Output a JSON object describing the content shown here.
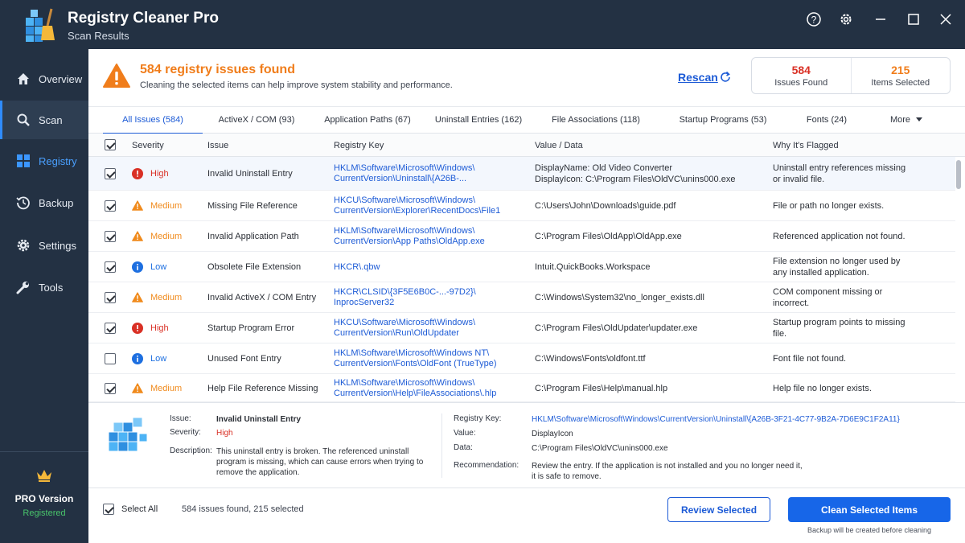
{
  "app": {
    "title": "Registry Cleaner Pro",
    "subtitle": "Scan Results"
  },
  "window_controls": [
    "help-icon",
    "settings-icon",
    "minimize-icon",
    "maximize-icon",
    "close-icon"
  ],
  "sidebar": {
    "items": [
      {
        "label": "Overview",
        "icon": "home-icon"
      },
      {
        "label": "Scan",
        "icon": "search-icon"
      },
      {
        "label": "Registry",
        "icon": "grid-icon"
      },
      {
        "label": "Backup",
        "icon": "history-icon"
      },
      {
        "label": "Settings",
        "icon": "gear-icon"
      },
      {
        "label": "Tools",
        "icon": "wrench-icon"
      }
    ],
    "pro": {
      "title": "PRO Version",
      "status": "Registered"
    }
  },
  "header": {
    "title": "584 registry issues found",
    "subtitle": "Cleaning the selected items can help improve system stability and performance.",
    "rescan": "Rescan",
    "stats": [
      {
        "value": "584",
        "label": "Issues Found",
        "color": "#d93025"
      },
      {
        "value": "215",
        "label": "Items Selected",
        "color": "#f07d1b"
      }
    ]
  },
  "tabs": [
    "All Issues (584)",
    "ActiveX / COM (93)",
    "Application Paths (67)",
    "Uninstall Entries (162)",
    "File Associations (118)",
    "Startup Programs (53)",
    "Fonts (24)",
    "More"
  ],
  "table": {
    "headers": [
      "Severity",
      "Issue",
      "Registry Key",
      "Value / Data",
      "Why It's Flagged"
    ],
    "rows": [
      {
        "checked": true,
        "severity": "High",
        "issue": "Invalid Uninstall Entry",
        "key": [
          "HKLM\\Software\\Microsoft\\Windows\\",
          "CurrentVersion\\Uninstall\\{A26B-..."
        ],
        "value": [
          "DisplayName: Old Video Converter",
          "DisplayIcon: C:\\Program Files\\OldVC\\unins000.exe"
        ],
        "why": [
          "Uninstall entry references missing",
          "or invalid file."
        ]
      },
      {
        "checked": true,
        "severity": "Medium",
        "issue": "Missing File Reference",
        "key": [
          "HKCU\\Software\\Microsoft\\Windows\\",
          "CurrentVersion\\Explorer\\RecentDocs\\File1"
        ],
        "value": [
          "C:\\Users\\John\\Downloads\\guide.pdf"
        ],
        "why": [
          "File or path no longer exists."
        ]
      },
      {
        "checked": true,
        "severity": "Medium",
        "issue": "Invalid Application Path",
        "key": [
          "HKLM\\Software\\Microsoft\\Windows\\",
          "CurrentVersion\\App Paths\\OldApp.exe"
        ],
        "value": [
          "C:\\Program Files\\OldApp\\OldApp.exe"
        ],
        "why": [
          "Referenced application not found."
        ]
      },
      {
        "checked": true,
        "severity": "Low",
        "issue": "Obsolete File Extension",
        "key": [
          "HKCR\\.qbw"
        ],
        "value": [
          "Intuit.QuickBooks.Workspace"
        ],
        "why": [
          "File extension no longer used by",
          "any installed application."
        ]
      },
      {
        "checked": true,
        "severity": "Medium",
        "issue": "Invalid ActiveX / COM Entry",
        "key": [
          "HKCR\\CLSID\\{3F5E6B0C-...-97D2}\\",
          "InprocServer32"
        ],
        "value": [
          "C:\\Windows\\System32\\no_longer_exists.dll"
        ],
        "why": [
          "COM component missing or",
          "incorrect."
        ]
      },
      {
        "checked": true,
        "severity": "High",
        "issue": "Startup Program Error",
        "key": [
          "HKCU\\Software\\Microsoft\\Windows\\",
          "CurrentVersion\\Run\\OldUpdater"
        ],
        "value": [
          "C:\\Program Files\\OldUpdater\\updater.exe"
        ],
        "why": [
          "Startup program points to missing",
          "file."
        ]
      },
      {
        "checked": false,
        "severity": "Low",
        "issue": "Unused Font Entry",
        "key": [
          "HKLM\\Software\\Microsoft\\Windows NT\\",
          "CurrentVersion\\Fonts\\OldFont (TrueType)"
        ],
        "value": [
          "C:\\Windows\\Fonts\\oldfont.ttf"
        ],
        "why": [
          "Font file not found."
        ]
      },
      {
        "checked": true,
        "severity": "Medium",
        "issue": "Help File Reference Missing",
        "key": [
          "HKLM\\Software\\Microsoft\\Windows\\",
          "CurrentVersion\\Help\\FileAssociations\\.hlp"
        ],
        "value": [
          "C:\\Program Files\\Help\\manual.hlp"
        ],
        "why": [
          "Help file no longer exists."
        ]
      }
    ]
  },
  "severity_colors": {
    "High": "#d93025",
    "Medium": "#f08a1c",
    "Low": "#1d6fe0"
  },
  "details": {
    "issue_label": "Issue:",
    "issue": "Invalid Uninstall Entry",
    "severity_label": "Severity:",
    "severity": "High",
    "description_label": "Description:",
    "description": [
      "This uninstall entry is broken. The referenced uninstall",
      "program is missing, which can cause errors when trying to",
      "remove the application."
    ],
    "key_label": "Registry Key:",
    "key": "HKLM\\Software\\Microsoft\\Windows\\CurrentVersion\\Uninstall\\{A26B-3F21-4C77-9B2A-7D6E9C1F2A11}",
    "value_label": "Value:",
    "value": "DisplayIcon",
    "data_label": "Data:",
    "data": "C:\\Program Files\\OldVC\\unins000.exe",
    "rec_label": "Recommendation:",
    "recommendation": [
      "Review the entry. If the application is not installed and you no longer need it,",
      "it is safe to remove."
    ]
  },
  "footer": {
    "select_all": "Select All",
    "summary": "584 issues found, 215 selected",
    "review": "Review Selected",
    "clean": "Clean Selected Items",
    "note": "Backup will be created before cleaning"
  }
}
